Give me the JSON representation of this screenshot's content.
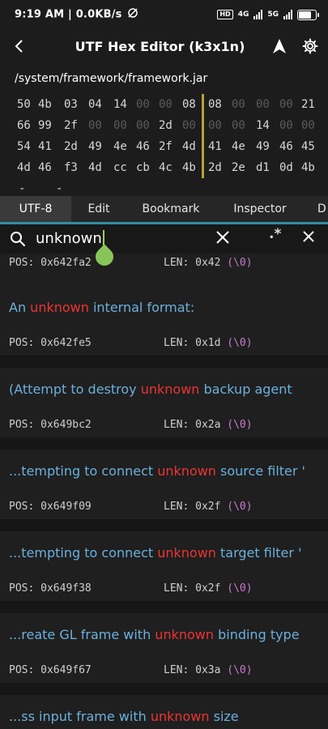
{
  "status": {
    "time": "9:19 AM",
    "speed": "0.0KB/s",
    "separator": "|",
    "hd_label": "HD",
    "net1": "4G",
    "net2": "5G",
    "battery_level": 0.85
  },
  "appbar": {
    "title": "UTF Hex Editor (k3x1n)"
  },
  "file_path": "/system/framework/framework.jar",
  "hex_rows": [
    [
      "50",
      "4b",
      "03",
      "04",
      "14",
      "00",
      "00",
      "08",
      "08",
      "00",
      "00",
      "00",
      "21"
    ],
    [
      "66",
      "99",
      "2f",
      "00",
      "00",
      "00",
      "2d",
      "00",
      "00",
      "00",
      "14",
      "00",
      "00"
    ],
    [
      "54",
      "41",
      "2d",
      "49",
      "4e",
      "46",
      "2f",
      "4d",
      "41",
      "4e",
      "49",
      "46",
      "45"
    ],
    [
      "4d",
      "46",
      "f3",
      "4d",
      "cc",
      "cb",
      "4c",
      "4b",
      "2d",
      "2e",
      "d1",
      "0d",
      "4b"
    ]
  ],
  "hex_partial": [
    "-",
    "-"
  ],
  "tabs": [
    "UTF-8",
    "Edit",
    "Bookmark",
    "Inspector",
    "D"
  ],
  "active_tab": 0,
  "search": {
    "query": "unknown",
    "regex_label": ".*"
  },
  "results": [
    {
      "pos": "POS: 0x642fa2",
      "len": "LEN: 0x42",
      "null": "(\\0)"
    },
    {
      "before": "An ",
      "match": "unknown",
      "after": " internal format:",
      "pos": "POS: 0x642fe5",
      "len": "LEN: 0x1d",
      "null": "(\\0)"
    },
    {
      "before": "(Attempt to destroy ",
      "match": "unknown",
      "after": " backup agent",
      "pos": "POS: 0x649bc2",
      "len": "LEN: 0x2a",
      "null": "(\\0)"
    },
    {
      "before": "...tempting to connect ",
      "match": "unknown",
      "after": " source filter '",
      "pos": "POS: 0x649f09",
      "len": "LEN: 0x2f",
      "null": "(\\0)"
    },
    {
      "before": "...tempting to connect ",
      "match": "unknown",
      "after": " target filter '",
      "pos": "POS: 0x649f38",
      "len": "LEN: 0x2f",
      "null": "(\\0)"
    },
    {
      "before": "...reate GL frame with ",
      "match": "unknown",
      "after": " binding type",
      "pos": "POS: 0x649f67",
      "len": "LEN: 0x3a",
      "null": "(\\0)"
    },
    {
      "before": "...ss input frame with ",
      "match": "unknown",
      "after": " size"
    }
  ],
  "colors": {
    "match": "#ee3333",
    "text": "#6ab0dd",
    "null_marker": "#c77ad0",
    "tab_indicator": "#2f8fa3",
    "hex_divider": "#b8a035",
    "cursor": "#89c45a"
  }
}
